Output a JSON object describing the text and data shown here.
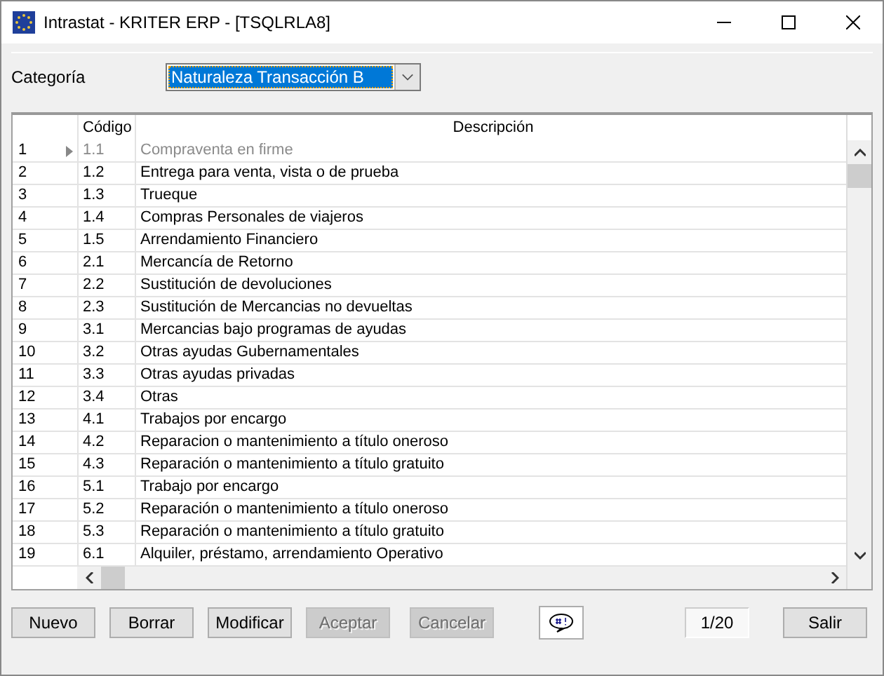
{
  "window": {
    "title": "Intrastat - KRITER ERP - [TSQLRLA8]"
  },
  "category": {
    "label": "Categoría",
    "value": "Naturaleza Transacción B"
  },
  "table": {
    "columns": [
      "Código",
      "Descripción"
    ],
    "rows": [
      {
        "number": "1",
        "code": "1.1",
        "description": "Compraventa en firme",
        "selected": true
      },
      {
        "number": "2",
        "code": "1.2",
        "description": "Entrega para venta, vista o de prueba",
        "selected": false
      },
      {
        "number": "3",
        "code": "1.3",
        "description": "Trueque",
        "selected": false
      },
      {
        "number": "4",
        "code": "1.4",
        "description": "Compras Personales de viajeros",
        "selected": false
      },
      {
        "number": "5",
        "code": "1.5",
        "description": "Arrendamiento Financiero",
        "selected": false
      },
      {
        "number": "6",
        "code": "2.1",
        "description": "Mercancía de Retorno",
        "selected": false
      },
      {
        "number": "7",
        "code": "2.2",
        "description": "Sustitución de devoluciones",
        "selected": false
      },
      {
        "number": "8",
        "code": "2.3",
        "description": "Sustitución de Mercancias no devueltas",
        "selected": false
      },
      {
        "number": "9",
        "code": "3.1",
        "description": "Mercancias bajo programas de ayudas",
        "selected": false
      },
      {
        "number": "10",
        "code": "3.2",
        "description": "Otras ayudas  Gubernamentales",
        "selected": false
      },
      {
        "number": "11",
        "code": "3.3",
        "description": "Otras ayudas privadas",
        "selected": false
      },
      {
        "number": "12",
        "code": "3.4",
        "description": "Otras",
        "selected": false
      },
      {
        "number": "13",
        "code": "4.1",
        "description": "Trabajos por  encargo",
        "selected": false
      },
      {
        "number": "14",
        "code": "4.2",
        "description": "Reparacion o mantenimiento a título oneroso",
        "selected": false
      },
      {
        "number": "15",
        "code": "4.3",
        "description": "Reparación o mantenimiento a título gratuito",
        "selected": false
      },
      {
        "number": "16",
        "code": "5.1",
        "description": "Trabajo por encargo",
        "selected": false
      },
      {
        "number": "17",
        "code": "5.2",
        "description": "Reparación o mantenimiento a título oneroso",
        "selected": false
      },
      {
        "number": "18",
        "code": "5.3",
        "description": "Reparación o mantenimiento a título gratuito",
        "selected": false
      },
      {
        "number": "19",
        "code": "6.1",
        "description": "Alquiler, préstamo, arrendamiento Operativo",
        "selected": false
      }
    ]
  },
  "buttons": [
    {
      "label": "Nuevo",
      "disabled": false
    },
    {
      "label": "Borrar",
      "disabled": false
    },
    {
      "label": "Modificar",
      "disabled": false
    },
    {
      "label": "Aceptar",
      "disabled": true
    },
    {
      "label": "Cancelar",
      "disabled": true
    }
  ],
  "record_counter": "1/20",
  "exit_button": "Salir"
}
